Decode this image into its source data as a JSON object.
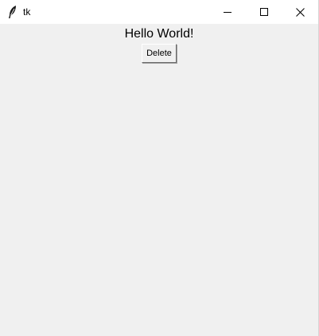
{
  "window": {
    "title": "tk",
    "icon": "feather-icon",
    "controls": {
      "minimize": "minimize-icon",
      "maximize": "maximize-icon",
      "close": "close-icon"
    }
  },
  "content": {
    "label_text": "Hello World!",
    "delete_button_label": "Delete"
  },
  "colors": {
    "titlebar_bg": "#ffffff",
    "client_bg": "#f0f0f0",
    "text": "#000000"
  }
}
